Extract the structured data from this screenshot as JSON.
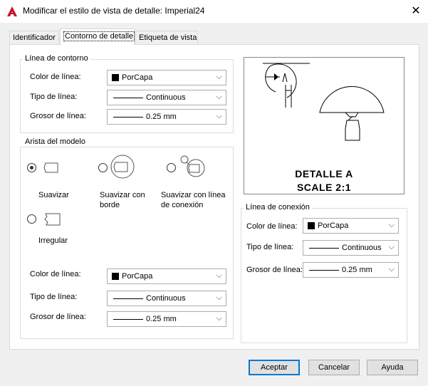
{
  "window": {
    "title": "Modificar el estilo de vista de detalle: Imperial24",
    "close_glyph": "✕",
    "app_icon": "autocad-icon"
  },
  "tabs": [
    {
      "label": "Identificador",
      "active": false
    },
    {
      "label": "Contorno de detalle",
      "active": true
    },
    {
      "label": "Etiqueta de vista",
      "active": false
    }
  ],
  "outline": {
    "group_label": "Línea de contorno",
    "color_label": "Color de línea:",
    "color_value": "PorCapa",
    "type_label": "Tipo de línea:",
    "type_value": "Continuous",
    "weight_label": "Grosor de línea:",
    "weight_value": "0.25 mm"
  },
  "edge": {
    "group_label": "Arista del modelo",
    "options": [
      {
        "label_line1": "Suavizar",
        "label_line2": "",
        "selected": true
      },
      {
        "label_line1": "Suavizar con",
        "label_line2": "borde",
        "selected": false
      },
      {
        "label_line1": "Suavizar con línea",
        "label_line2": "de conexión",
        "selected": false
      },
      {
        "label_line1": "Irregular",
        "label_line2": "",
        "selected": false
      }
    ],
    "color_label": "Color de línea:",
    "color_value": "PorCapa",
    "type_label": "Tipo de línea:",
    "type_value": "Continuous",
    "weight_label": "Grosor de línea:",
    "weight_value": "0.25 mm"
  },
  "connection": {
    "group_label": "Línea de conexión",
    "color_label": "Color de línea:",
    "color_value": "PorCapa",
    "type_label": "Tipo de línea:",
    "type_value": "Continuous",
    "weight_label": "Grosor de línea:",
    "weight_value": "0.25 mm"
  },
  "preview": {
    "caption_line1": "DETALLE A",
    "caption_line2": "SCALE 2:1"
  },
  "buttons": {
    "accept": "Aceptar",
    "cancel": "Cancelar",
    "help": "Ayuda"
  },
  "colors": {
    "accent": "#0078d7",
    "app_icon_red": "#c8102e"
  }
}
